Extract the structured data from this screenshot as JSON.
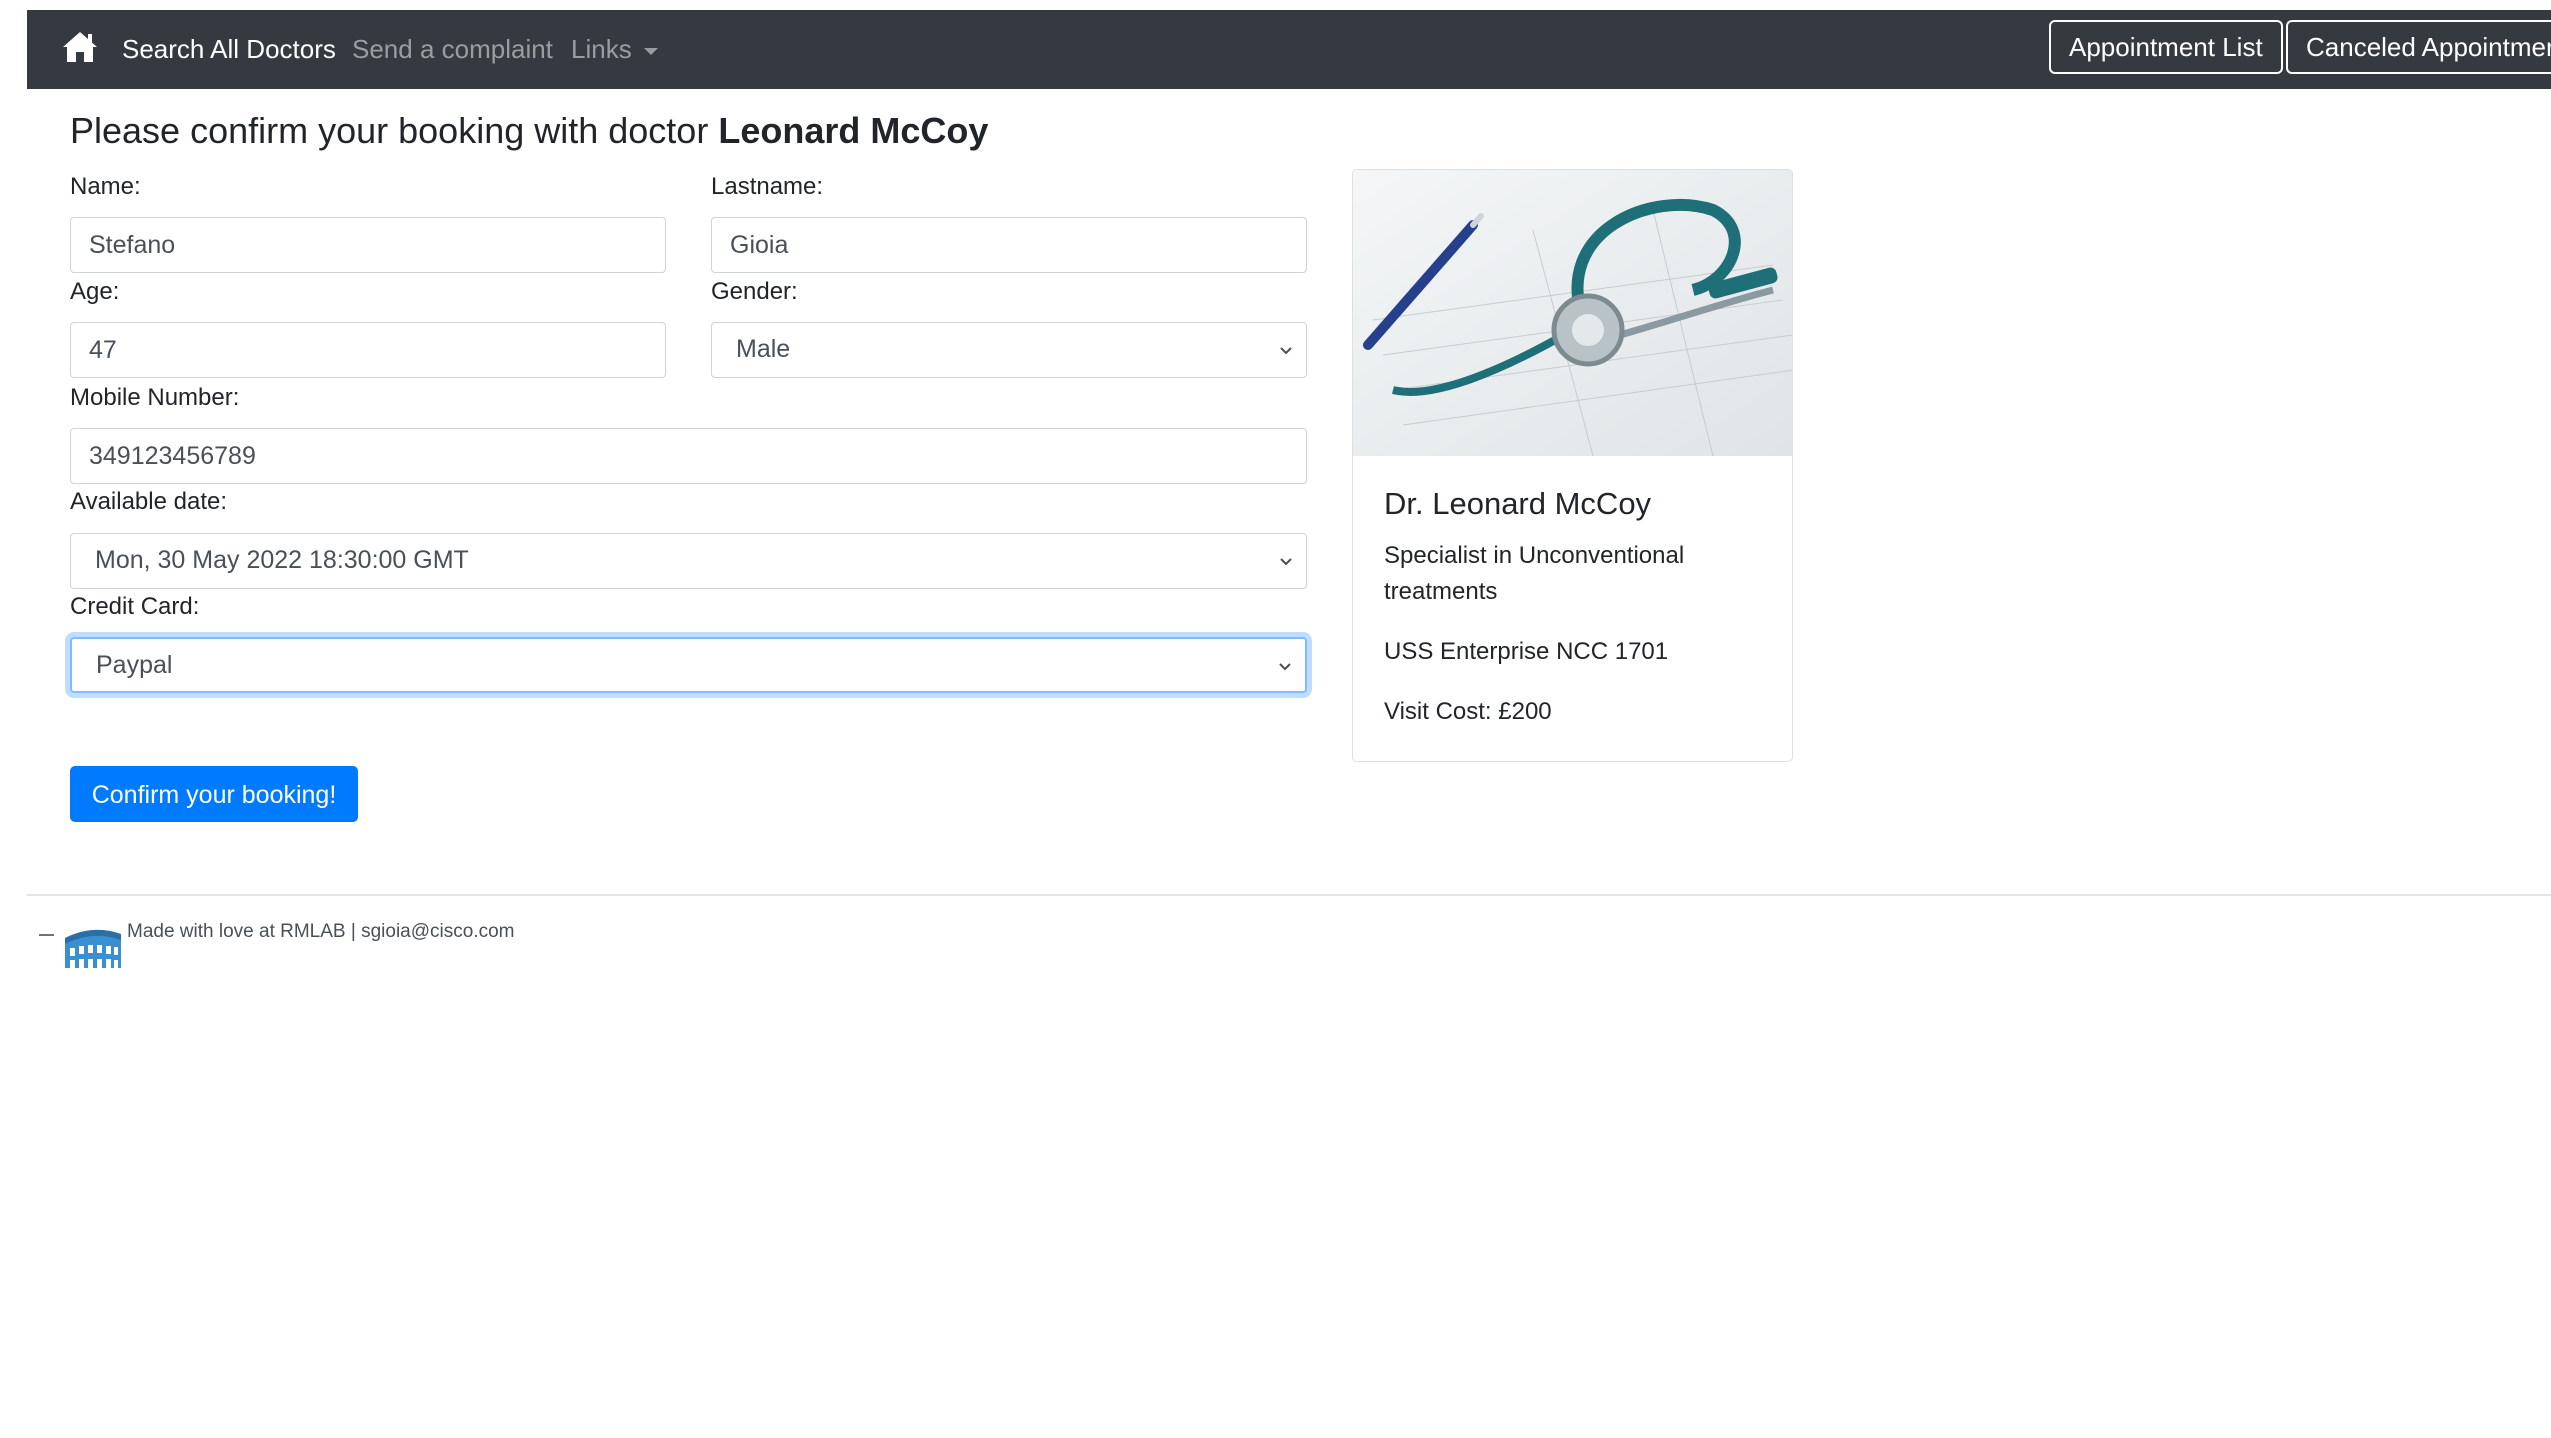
{
  "nav": {
    "home_icon": "home-icon",
    "links": [
      "Search All Doctors",
      "Send a complaint",
      "Links"
    ],
    "appointment_list": "Appointment List",
    "canceled_appointments": "Canceled Appointmen"
  },
  "heading": {
    "prefix": "Please confirm your booking with doctor",
    "doctor": "Leonard McCoy"
  },
  "form": {
    "name_label": "Name:",
    "name_value": "Stefano",
    "lastname_label": "Lastname:",
    "lastname_value": "Gioia",
    "age_label": "Age:",
    "age_value": "47",
    "gender_label": "Gender:",
    "gender_value": "Male",
    "mobile_label": "Mobile Number:",
    "mobile_value": "349123456789",
    "date_label": "Available date:",
    "date_value": "Mon, 30 May 2022 18:30:00 GMT",
    "card_label": "Credit Card:",
    "card_value": "Paypal",
    "submit": "Confirm your booking!"
  },
  "doctor_card": {
    "name": "Dr. Leonard McCoy",
    "specialty": "Specialist in Unconventional treatments",
    "location": "USS Enterprise NCC 1701",
    "cost": "Visit Cost: £200",
    "image": "stethoscope-photo"
  },
  "footer": {
    "logo": "colosseum-logo",
    "text": "Made with love at RMLAB | sgioia@cisco.com"
  },
  "colors": {
    "navbar": "#343a40",
    "primary": "#007bff",
    "focus": "#80bdff"
  }
}
